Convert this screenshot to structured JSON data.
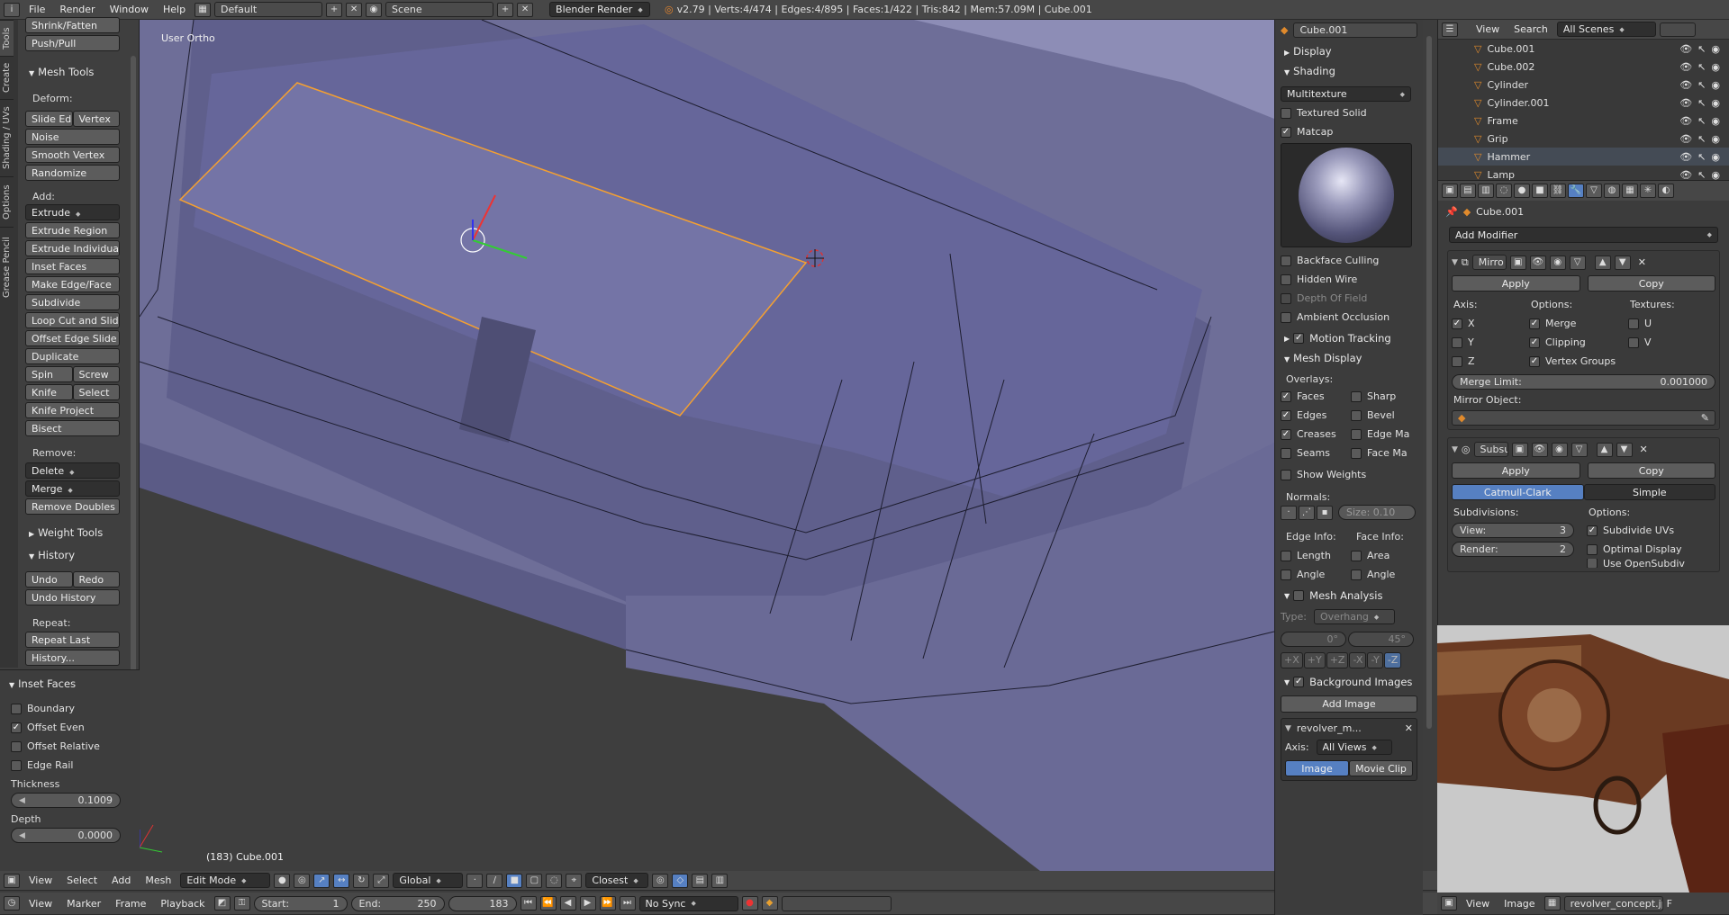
{
  "topbar": {
    "menus": [
      "File",
      "Render",
      "Window",
      "Help"
    ],
    "screen_layout": "Default",
    "scene": "Scene",
    "engine": "Blender Render",
    "stats": "v2.79 | Verts:4/474 | Edges:4/895 | Faces:1/422 | Tris:842 | Mem:57.09M | Cube.001"
  },
  "tool_tabs": [
    "Tools",
    "Create",
    "Shading / UVs",
    "Options",
    "Grease Pencil"
  ],
  "tools": {
    "top_buttons": [
      "Shrink/Fatten",
      "Push/Pull"
    ],
    "mesh_tools_header": "Mesh Tools",
    "deform_label": "Deform:",
    "deform_row": [
      "Slide Ed",
      "Vertex"
    ],
    "deform_buttons": [
      "Noise",
      "Smooth Vertex",
      "Randomize"
    ],
    "add_label": "Add:",
    "extrude": "Extrude",
    "add_buttons": [
      "Extrude Region",
      "Extrude Individual",
      "Inset Faces",
      "Make Edge/Face",
      "Subdivide",
      "Loop Cut and Slide",
      "Offset Edge Slide",
      "Duplicate"
    ],
    "spin_row": [
      "Spin",
      "Screw"
    ],
    "knife_row": [
      "Knife",
      "Select"
    ],
    "add_buttons2": [
      "Knife Project",
      "Bisect"
    ],
    "remove_label": "Remove:",
    "delete": "Delete",
    "merge": "Merge",
    "remove_doubles": "Remove Doubles",
    "weight_tools": "Weight Tools",
    "history_header": "History",
    "undo_row": [
      "Undo",
      "Redo"
    ],
    "undo_history": "Undo History",
    "repeat_label": "Repeat:",
    "repeat_last": "Repeat Last",
    "history_btn": "History..."
  },
  "operator": {
    "header": "Inset Faces",
    "options": [
      {
        "label": "Boundary",
        "checked": false
      },
      {
        "label": "Offset Even",
        "checked": true
      },
      {
        "label": "Offset Relative",
        "checked": false
      },
      {
        "label": "Edge Rail",
        "checked": false
      }
    ],
    "thickness_label": "Thickness",
    "thickness": "0.1009",
    "depth_label": "Depth",
    "depth": "0.0000"
  },
  "viewport": {
    "view_name": "User Ortho",
    "object_info": "(183) Cube.001"
  },
  "viewport_header": {
    "menus": [
      "View",
      "Select",
      "Add",
      "Mesh"
    ],
    "mode": "Edit Mode",
    "orientation": "Global",
    "snap": "Closest"
  },
  "timeline": {
    "menus": [
      "View",
      "Marker",
      "Frame",
      "Playback"
    ],
    "start_label": "Start:",
    "start": "1",
    "end_label": "End:",
    "end": "250",
    "current": "183",
    "sync": "No Sync"
  },
  "n_panel": {
    "object_name": "Cube.001",
    "display": "Display",
    "shading": "Shading",
    "shading_mode": "Multitexture",
    "textured_solid": "Textured Solid",
    "matcap": "Matcap",
    "backface": "Backface Culling",
    "hidden_wire": "Hidden Wire",
    "dof": "Depth Of Field",
    "ao": "Ambient Occlusion",
    "motion_tracking": "Motion Tracking",
    "mesh_display": "Mesh Display",
    "overlays_label": "Overlays:",
    "overlays_left": [
      "Faces",
      "Edges",
      "Creases",
      "Seams"
    ],
    "overlays_right": [
      "Sharp",
      "Bevel",
      "Edge Ma",
      "Face Ma"
    ],
    "show_weights": "Show Weights",
    "normals_label": "Normals:",
    "size": "Size:  0.10",
    "edge_info": "Edge Info:",
    "face_info": "Face Info:",
    "length": "Length",
    "area": "Area",
    "angle1": "Angle",
    "angle2": "Angle",
    "mesh_analysis": "Mesh Analysis",
    "type_label": "Type:",
    "type_value": "Overhang",
    "angle_min": "0°",
    "angle_max": "45°",
    "axes": [
      "+X",
      "+Y",
      "+Z",
      "-X",
      "-Y",
      "-Z"
    ],
    "bg_images": "Background Images",
    "add_image": "Add Image",
    "bg_file": "revolver_m...",
    "axis_label": "Axis:",
    "axis_value": "All Views",
    "tab_image": "Image",
    "tab_clip": "Movie Clip"
  },
  "outliner": {
    "menus": [
      "View",
      "Search"
    ],
    "scenes": "All Scenes",
    "items": [
      "Cube.001",
      "Cube.002",
      "Cylinder",
      "Cylinder.001",
      "Frame",
      "Grip",
      "Hammer",
      "Lamp"
    ]
  },
  "modifiers": {
    "object": "Cube.001",
    "add_modifier": "Add Modifier",
    "mirror": {
      "name": "Mirro",
      "apply": "Apply",
      "copy": "Copy",
      "axis_label": "Axis:",
      "options_label": "Options:",
      "textures_label": "Textures:",
      "axes": [
        {
          "l": "X",
          "c": true
        },
        {
          "l": "Y",
          "c": false
        },
        {
          "l": "Z",
          "c": false
        }
      ],
      "options": [
        {
          "l": "Merge",
          "c": true
        },
        {
          "l": "Clipping",
          "c": true
        },
        {
          "l": "Vertex Groups",
          "c": true
        }
      ],
      "textures": [
        "U",
        "V"
      ],
      "merge_limit_label": "Merge Limit:",
      "merge_limit": "0.001000",
      "mirror_object": "Mirror Object:"
    },
    "subsurf": {
      "name": "Subsu",
      "apply": "Apply",
      "copy": "Copy",
      "tab_cc": "Catmull-Clark",
      "tab_simple": "Simple",
      "subdivisions": "Subdivisions:",
      "options": "Options:",
      "view_label": "View:",
      "view": "3",
      "render_label": "Render:",
      "render": "2",
      "subdivide_uvs": "Subdivide UVs",
      "optimal": "Optimal Display",
      "opensubdiv": "Use OpenSubdiv"
    }
  },
  "image_editor": {
    "menus": [
      "View",
      "Image"
    ],
    "filename": "revolver_concept.jp...",
    "f": "F"
  },
  "colors": {
    "accent": "#5680c2",
    "selection": "#f0a030",
    "mesh": "#6f6f9a"
  }
}
